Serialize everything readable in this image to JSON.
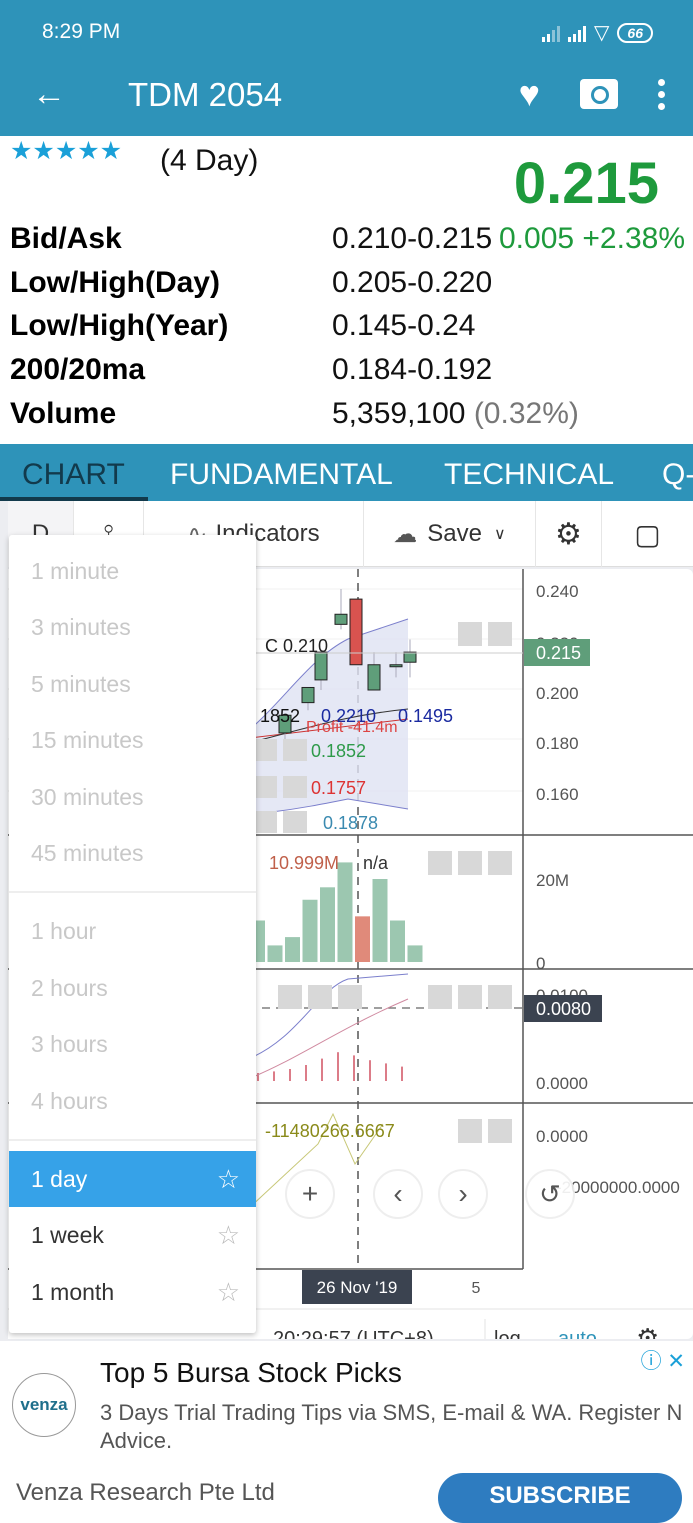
{
  "status_bar": {
    "time": "8:29 PM",
    "battery": "66"
  },
  "app_bar": {
    "title": "TDM 2054"
  },
  "quote": {
    "rating_stars": 5,
    "period": "(4 Day)",
    "price": "0.215",
    "change": "0.005 +2.38%",
    "rows": [
      {
        "label": "Bid/Ask",
        "value": "0.210-0.215"
      },
      {
        "label": "Low/High(Day)",
        "value": "0.205-0.220"
      },
      {
        "label": "Low/High(Year)",
        "value": "0.145-0.24"
      },
      {
        "label": "200/20ma",
        "value": "0.184-0.192"
      },
      {
        "label": "Volume",
        "value": "5,359,100",
        "extra": "(0.32%)"
      }
    ]
  },
  "tabs": [
    {
      "label": "CHART",
      "active": true
    },
    {
      "label": "FUNDAMENTAL",
      "active": false
    },
    {
      "label": "TECHNICAL",
      "active": false
    },
    {
      "label": "Q-",
      "active": false
    }
  ],
  "toolbar": {
    "interval": "D",
    "indicators_label": "Indicators",
    "save_label": "Save"
  },
  "interval_menu": {
    "groups": [
      [
        "1 minute",
        "3 minutes",
        "5 minutes",
        "15 minutes",
        "30 minutes",
        "45 minutes"
      ],
      [
        "1 hour",
        "2 hours",
        "3 hours",
        "4 hours"
      ],
      [
        "1 day",
        "1 week",
        "1 month"
      ]
    ],
    "selected": "1 day"
  },
  "chart": {
    "price_axis": [
      "0.240",
      "0.220",
      "0.200",
      "0.180",
      "0.160"
    ],
    "last_price_tag": "0.215",
    "close_label": "C 0.210",
    "legend_values": {
      "black": "1852",
      "blue": "0.2210",
      "blue2": "0.1495",
      "profit": "Profit -41.4m",
      "green": "0.1852",
      "red": "0.1757",
      "teal": "0.1878"
    },
    "volume_label": "10.999M",
    "volume_na": "n/a",
    "volume_axis": [
      "20M",
      "0"
    ],
    "macd_axis": [
      "0.0100",
      "0.0000"
    ],
    "macd_tag": "0.0080",
    "osc_label": "-11480266.6667",
    "osc_axis": [
      "0.0000",
      "-20000000.0000"
    ],
    "date_tag": "26 Nov '19",
    "x_tick": "5",
    "clock": "20:29:57 (UTC+8)",
    "log_label": "log",
    "auto_label": "auto"
  },
  "chart_data": {
    "type": "candlestick",
    "candles": [
      {
        "o": 0.183,
        "h": 0.19,
        "l": 0.18,
        "c": 0.19,
        "up": true
      },
      {
        "o": 0.195,
        "h": 0.201,
        "l": 0.192,
        "c": 0.201,
        "up": true
      },
      {
        "o": 0.204,
        "h": 0.215,
        "l": 0.2,
        "c": 0.215,
        "up": true
      },
      {
        "o": 0.226,
        "h": 0.24,
        "l": 0.224,
        "c": 0.23,
        "up": true
      },
      {
        "o": 0.236,
        "h": 0.236,
        "l": 0.21,
        "c": 0.21,
        "up": false
      },
      {
        "o": 0.2,
        "h": 0.215,
        "l": 0.2,
        "c": 0.21,
        "up": true
      },
      {
        "o": 0.21,
        "h": 0.215,
        "l": 0.205,
        "c": 0.21,
        "up": true
      },
      {
        "o": 0.211,
        "h": 0.22,
        "l": 0.205,
        "c": 0.215,
        "up": true
      }
    ],
    "volumes_m": [
      10,
      4,
      6,
      15,
      18,
      24,
      10.999,
      20,
      10,
      4
    ],
    "volume_colors": [
      "up",
      "up",
      "up",
      "up",
      "up",
      "up",
      "down",
      "up",
      "up",
      "up"
    ],
    "macd_hist": [
      0.001,
      0.0012,
      0.0015,
      0.002,
      0.0028,
      0.0036,
      0.0032,
      0.0026,
      0.0022,
      0.0018
    ],
    "ylim": [
      0.15,
      0.245
    ]
  },
  "ad": {
    "logo": "venza",
    "title": "Top 5 Bursa Stock Picks",
    "description": "3 Days Trial Trading Tips via SMS, E-mail & WA. Register N",
    "description2": "Advice.",
    "company": "Venza Research Pte Ltd",
    "cta": "SUBSCRIBE"
  },
  "colors": {
    "brand": "#2e93b9",
    "up": "#5f9e7a",
    "down": "#d9534f",
    "selected": "#36a2e8"
  }
}
